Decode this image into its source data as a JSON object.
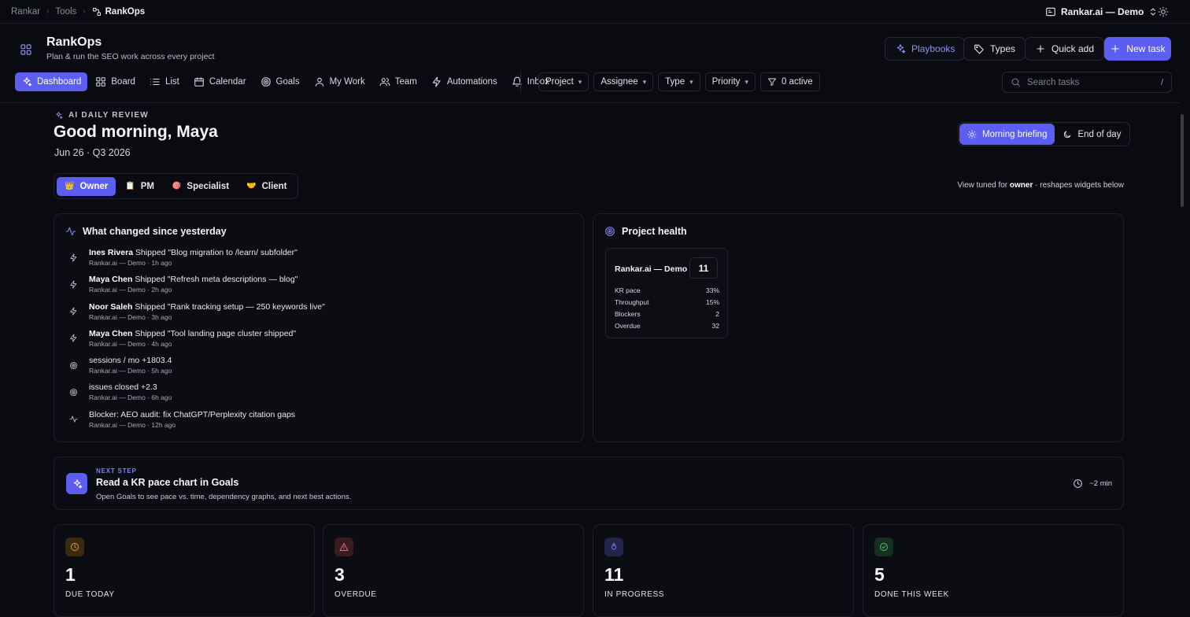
{
  "breadcrumb": {
    "items": [
      "Rankar",
      "Tools"
    ],
    "current": "RankOps"
  },
  "workspace": {
    "name": "Rankar.ai — Demo"
  },
  "app": {
    "title": "RankOps",
    "subtitle": "Plan & run the SEO work across every project"
  },
  "header_actions": {
    "playbooks": "Playbooks",
    "types": "Types",
    "quick_add": "Quick add",
    "new_task": "New task"
  },
  "nav": {
    "items": [
      {
        "label": "Dashboard",
        "icon": "sparkles-icon",
        "active": true
      },
      {
        "label": "Board",
        "icon": "grid-icon"
      },
      {
        "label": "List",
        "icon": "list-icon"
      },
      {
        "label": "Calendar",
        "icon": "calendar-icon"
      },
      {
        "label": "Goals",
        "icon": "target-icon"
      },
      {
        "label": "My Work",
        "icon": "user-icon"
      },
      {
        "label": "Team",
        "icon": "users-icon"
      },
      {
        "label": "Automations",
        "icon": "bolt-icon"
      },
      {
        "label": "Inbox",
        "icon": "bell-icon"
      }
    ]
  },
  "filters": {
    "project": "Project",
    "assignee": "Assignee",
    "type": "Type",
    "priority": "Priority",
    "active": "0 active"
  },
  "search": {
    "placeholder": "Search tasks",
    "shortcut": "/"
  },
  "review": {
    "label": "AI DAILY REVIEW",
    "greeting": "Good morning, Maya",
    "date": "Jun 26 · Q3 2026",
    "toggle": {
      "morning": "Morning briefing",
      "end_of_day": "End of day"
    },
    "roles": [
      "Owner",
      "PM",
      "Specialist",
      "Client"
    ],
    "tuned_prefix": "View tuned for ",
    "tuned_role": "owner",
    "tuned_suffix": " · reshapes widgets below"
  },
  "changes": {
    "title": "What changed since yesterday",
    "items": [
      {
        "icon": "bolt-icon",
        "who": "Ines Rivera",
        "text": " Shipped \"Blog migration to /learn/ subfolder\"",
        "meta": "Rankar.ai — Demo · 1h ago"
      },
      {
        "icon": "bolt-icon",
        "who": "Maya Chen",
        "text": " Shipped \"Refresh meta descriptions — blog\"",
        "meta": "Rankar.ai — Demo · 2h ago"
      },
      {
        "icon": "bolt-icon",
        "who": "Noor Saleh",
        "text": " Shipped \"Rank tracking setup — 250 keywords live\"",
        "meta": "Rankar.ai — Demo · 3h ago"
      },
      {
        "icon": "bolt-icon",
        "who": "Maya Chen",
        "text": " Shipped \"Tool landing page cluster shipped\"",
        "meta": "Rankar.ai — Demo · 4h ago"
      },
      {
        "icon": "target-icon",
        "who": "",
        "text": "sessions / mo +1803.4",
        "meta": "Rankar.ai — Demo · 5h ago"
      },
      {
        "icon": "target-icon",
        "who": "",
        "text": "issues closed +2.3",
        "meta": "Rankar.ai — Demo · 6h ago"
      },
      {
        "icon": "pulse-icon",
        "who": "",
        "text": "Blocker: AEO audit: fix ChatGPT/Perplexity citation gaps",
        "meta": "Rankar.ai — Demo · 12h ago"
      }
    ]
  },
  "health": {
    "title": "Project health",
    "project": "Rankar.ai — Demo",
    "count": "11",
    "rows": [
      {
        "label": "KR pace",
        "value": "33%"
      },
      {
        "label": "Throughput",
        "value": "15%"
      },
      {
        "label": "Blockers",
        "value": "2"
      },
      {
        "label": "Overdue",
        "value": "32"
      }
    ]
  },
  "next_step": {
    "kicker": "NEXT STEP",
    "title": "Read a KR pace chart in Goals",
    "desc": "Open Goals to see pace vs. time, dependency graphs, and next best actions.",
    "time": "~2 min"
  },
  "stats": [
    {
      "value": "1",
      "label": "DUE TODAY",
      "icon": "clock-icon"
    },
    {
      "value": "3",
      "label": "OVERDUE",
      "icon": "warning-icon"
    },
    {
      "value": "11",
      "label": "IN PROGRESS",
      "icon": "flame-icon"
    },
    {
      "value": "5",
      "label": "DONE THIS WEEK",
      "icon": "check-circle-icon"
    }
  ],
  "colors": {
    "accent": "#5b5ef0",
    "background": "#0a0b10"
  }
}
